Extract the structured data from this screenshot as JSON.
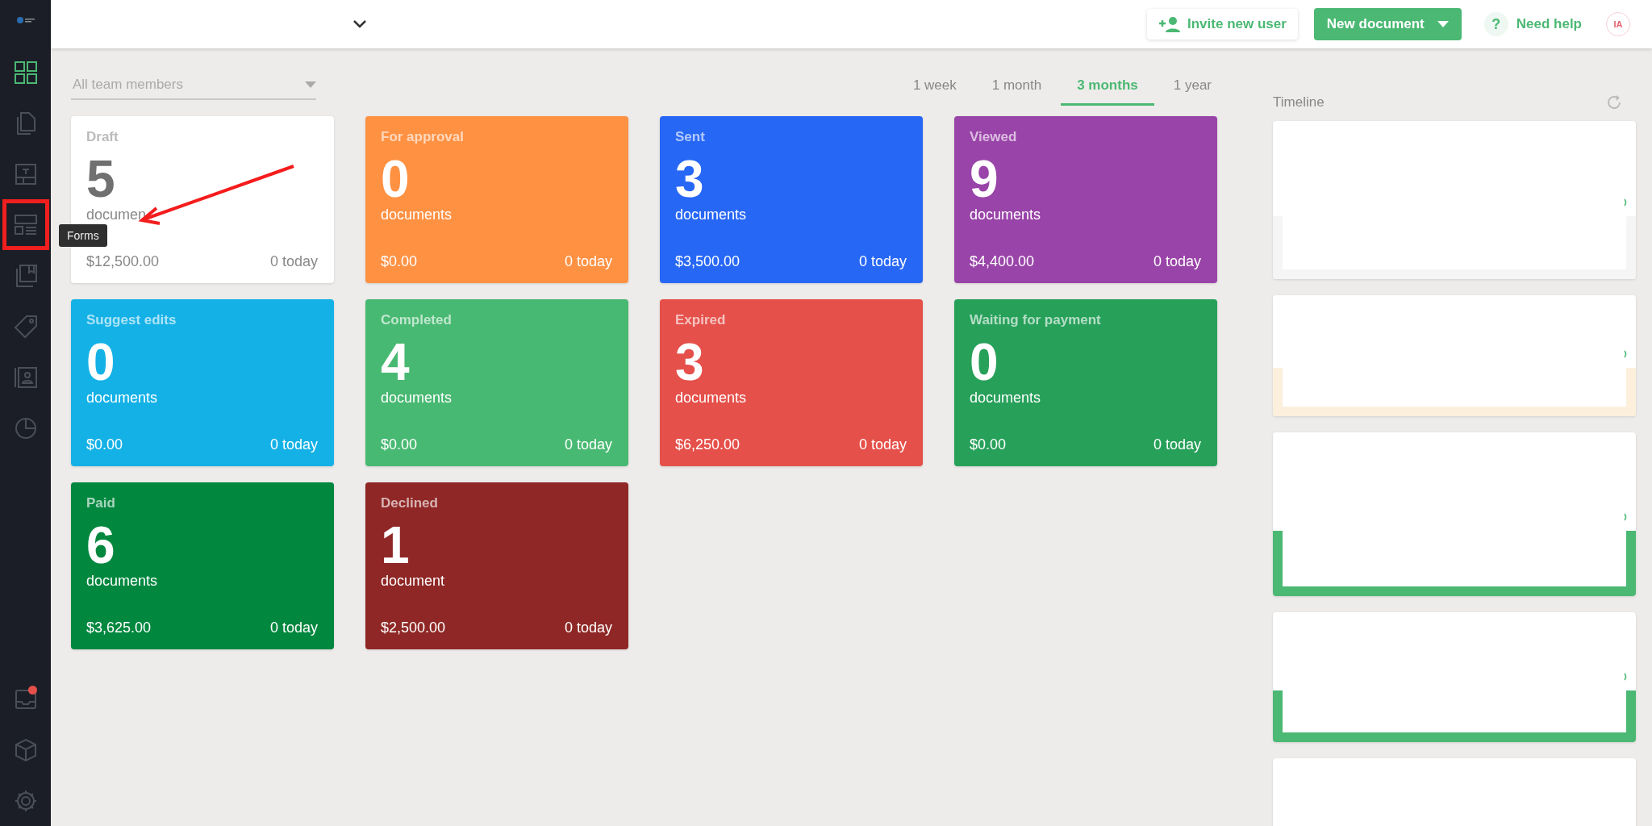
{
  "sidebar": {
    "items": [
      {
        "kind": "dashboard",
        "selected": true,
        "highlighted": false
      },
      {
        "kind": "documents",
        "selected": false,
        "highlighted": false
      },
      {
        "kind": "templates",
        "selected": false,
        "highlighted": false
      },
      {
        "kind": "forms",
        "selected": false,
        "highlighted": true
      },
      {
        "kind": "library",
        "selected": false,
        "highlighted": false
      },
      {
        "kind": "tag",
        "selected": false,
        "highlighted": false
      },
      {
        "kind": "contacts",
        "selected": false,
        "highlighted": false
      },
      {
        "kind": "reports",
        "selected": false,
        "highlighted": false
      }
    ],
    "bottom_items": [
      {
        "kind": "inbox",
        "notification": true
      },
      {
        "kind": "cube",
        "notification": false
      },
      {
        "kind": "settings",
        "notification": false
      }
    ],
    "tooltip": "Forms"
  },
  "header": {
    "invite_button": "Invite new user",
    "new_document_button": "New document",
    "help_icon": "?",
    "help_link": "Need help",
    "avatar": "IA"
  },
  "filter": {
    "placeholder": "All team members"
  },
  "period_tabs": [
    {
      "label": "1 week",
      "selected": false
    },
    {
      "label": "1 month",
      "selected": false
    },
    {
      "label": "3 months",
      "selected": true
    },
    {
      "label": "1 year",
      "selected": false
    }
  ],
  "status_cards": [
    {
      "title": "Draft",
      "count": "5",
      "unit": "documen",
      "amount": "$12,500.00",
      "today": "0 today",
      "color": "#ffffff"
    },
    {
      "title": "For approval",
      "count": "0",
      "unit": "documents",
      "amount": "$0.00",
      "today": "0 today",
      "color": "#ff9143"
    },
    {
      "title": "Sent",
      "count": "3",
      "unit": "documents",
      "amount": "$3,500.00",
      "today": "0 today",
      "color": "#2767f5"
    },
    {
      "title": "Viewed",
      "count": "9",
      "unit": "documents",
      "amount": "$4,400.00",
      "today": "0 today",
      "color": "#9944a8"
    },
    {
      "title": "Suggest edits",
      "count": "0",
      "unit": "documents",
      "amount": "$0.00",
      "today": "0 today",
      "color": "#14b1e6"
    },
    {
      "title": "Completed",
      "count": "4",
      "unit": "documents",
      "amount": "$0.00",
      "today": "0 today",
      "color": "#48b972"
    },
    {
      "title": "Expired",
      "count": "3",
      "unit": "documents",
      "amount": "$6,250.00",
      "today": "0 today",
      "color": "#e5504a"
    },
    {
      "title": "Waiting for payment",
      "count": "0",
      "unit": "documents",
      "amount": "$0.00",
      "today": "0 today",
      "color": "#27a05a"
    },
    {
      "title": "Paid",
      "count": "6",
      "unit": "documents",
      "amount": "$3,625.00",
      "today": "0 today",
      "color": "#02873f"
    },
    {
      "title": "Declined",
      "count": "1",
      "unit": "document",
      "amount": "$2,500.00",
      "today": "0 today",
      "color": "#8e2725"
    }
  ],
  "timeline": {
    "title": "Timeline",
    "cards": [
      {
        "kind": "banded",
        "color": "#f5f5f5"
      },
      {
        "kind": "banded",
        "color": "#fcf0dc"
      },
      {
        "kind": "banded",
        "color": "#4bb873"
      },
      {
        "kind": "banded",
        "color": "#4bb873"
      },
      {
        "kind": "plain"
      }
    ]
  }
}
